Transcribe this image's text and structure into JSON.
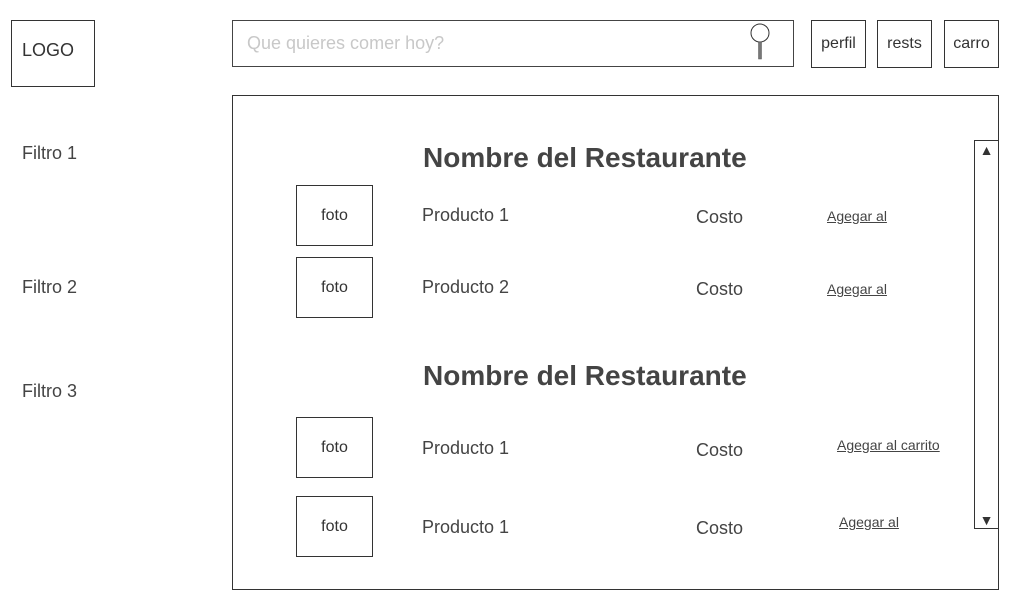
{
  "header": {
    "logo_text": "LOGO",
    "search": {
      "placeholder": "Que quieres comer hoy?",
      "icon": "search-icon"
    },
    "nav": {
      "perfil": "perfil",
      "rests": "rests",
      "carro": "carro"
    }
  },
  "sidebar": {
    "filters": [
      "Filtro 1",
      "Filtro 2",
      "Filtro 3"
    ]
  },
  "main": {
    "restaurants": [
      {
        "name": "Nombre del Restaurante",
        "items": [
          {
            "photo": "foto",
            "product": "Producto 1",
            "cost": "Costo",
            "add_label": "Agegar al"
          },
          {
            "photo": "foto",
            "product": "Producto 2",
            "cost": "Costo",
            "add_label": "Agegar al"
          }
        ]
      },
      {
        "name": "Nombre del Restaurante",
        "items": [
          {
            "photo": "foto",
            "product": "Producto 1",
            "cost": "Costo",
            "add_label": "Agegar al carrito"
          },
          {
            "photo": "foto",
            "product": "Producto 1",
            "cost": "Costo",
            "add_label": "Agegar al"
          }
        ]
      }
    ],
    "scrollbar": {
      "up_arrow": "▲",
      "down_arrow": "▼"
    }
  }
}
